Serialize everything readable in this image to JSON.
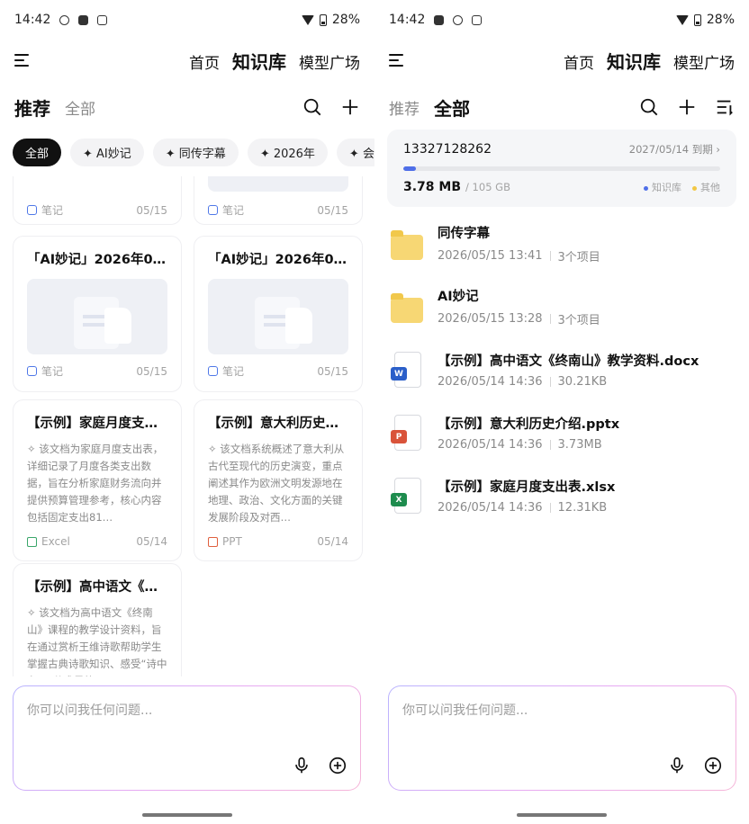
{
  "status": {
    "time": "14:42",
    "battery": "28%"
  },
  "nav": {
    "tabs": [
      "首页",
      "知识库",
      "模型广场"
    ],
    "active": "知识库"
  },
  "left": {
    "section_tabs": {
      "recommend": "推荐",
      "all": "全部"
    },
    "chips": [
      "全部",
      "✦ AI妙记",
      "✦ 同传字幕",
      "✦ 2026年",
      "✦ 会"
    ],
    "cards": [
      {
        "title": "",
        "type": "笔记",
        "date": "05/15",
        "typeclass": "note"
      },
      {
        "title": "",
        "type": "笔记",
        "date": "05/15",
        "typeclass": "note"
      },
      {
        "title": "「AI妙记」2026年0…",
        "type": "笔记",
        "date": "05/15",
        "typeclass": "note"
      },
      {
        "title": "「AI妙记」2026年0…",
        "type": "笔记",
        "date": "05/15",
        "typeclass": "note"
      },
      {
        "title": "【示例】家庭月度支…",
        "desc": "✧ 该文档为家庭月度支出表，详细记录了月度各类支出数据，旨在分析家庭财务流向并提供预算管理参考，核心内容包括固定支出81…",
        "type": "Excel",
        "date": "05/14",
        "typeclass": "excel"
      },
      {
        "title": "【示例】意大利历史…",
        "desc": "✧ 该文档系统概述了意大利从古代至现代的历史演变，重点阐述其作为欧洲文明发源地在地理、政治、文化方面的关键发展阶段及对西…",
        "type": "PPT",
        "date": "05/14",
        "typeclass": "ppt"
      },
      {
        "title": "【示例】高中语文《…",
        "desc": "✧ 该文档为高中语文《终南山》课程的教学设计资料，旨在通过赏析王维诗歌帮助学生掌握古典诗歌知识、感受“诗中有画”艺术风格…"
      }
    ]
  },
  "input": {
    "placeholder": "你可以问我任何问题..."
  },
  "right": {
    "section_tabs": {
      "recommend": "推荐",
      "all": "全部"
    },
    "storage": {
      "account": "13327128262",
      "expiry": "2027/05/14 到期 ›",
      "used": "3.78 MB",
      "total": "/ 105 GB",
      "used_fraction": 0.04,
      "legend": [
        "知识库",
        "其他"
      ]
    },
    "files": [
      {
        "name": "同传字幕",
        "date": "2026/05/15 13:41",
        "meta": "3个项目",
        "kind": "folder"
      },
      {
        "name": "AI妙记",
        "date": "2026/05/15 13:28",
        "meta": "3个项目",
        "kind": "folder"
      },
      {
        "name": "【示例】高中语文《终南山》教学资料.docx",
        "date": "2026/05/14 14:36",
        "meta": "30.21KB",
        "kind": "word",
        "badge": "W"
      },
      {
        "name": "【示例】意大利历史介绍.pptx",
        "date": "2026/05/14 14:36",
        "meta": "3.73MB",
        "kind": "ppt",
        "badge": "P"
      },
      {
        "name": "【示例】家庭月度支出表.xlsx",
        "date": "2026/05/14 14:36",
        "meta": "12.31KB",
        "kind": "excel",
        "badge": "X"
      }
    ]
  },
  "colors": {
    "word": "#2b5fc9",
    "ppt": "#d9533a",
    "excel": "#1e8c4e",
    "knowledge": "#4f6fe8",
    "other": "#f2c744"
  }
}
